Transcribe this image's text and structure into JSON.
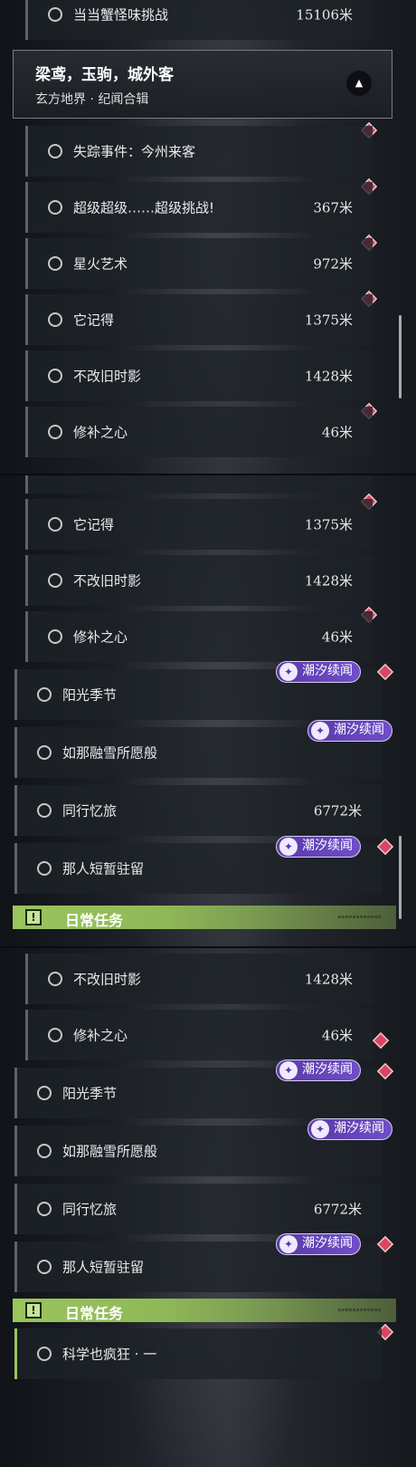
{
  "header": {
    "title": "梁鸢，玉驹，城外客",
    "subtitle": "玄方地界 · 纪闻合辑"
  },
  "daily_label": "日常任务",
  "badge_label": "潮汐续闻",
  "quests": {
    "dangdang": {
      "name": "当当蟹怪味挑战",
      "dist": "15106米"
    },
    "shizong": {
      "name": "失踪事件：今州来客"
    },
    "chaoji": {
      "name": "超级超级……超级挑战!",
      "dist": "367米"
    },
    "xinghuo": {
      "name": "星火艺术",
      "dist": "972米"
    },
    "tajide": {
      "name": "它记得",
      "dist": "1375米"
    },
    "bugai": {
      "name": "不改旧时影",
      "dist": "1428米"
    },
    "xiubu": {
      "name": "修补之心",
      "dist": "46米"
    },
    "yangguang": {
      "name": "阳光季节"
    },
    "rongxue": {
      "name": "如那融雪所愿般"
    },
    "tongxing": {
      "name": "同行忆旅",
      "dist": "6772米"
    },
    "narren": {
      "name": "那人短暂驻留"
    },
    "kexue": {
      "name": "科学也疯狂 · 一"
    }
  },
  "colors": {
    "marker": "#d9465f",
    "badge": "#5a3aa8",
    "daily_bar": "#9ac45c"
  }
}
